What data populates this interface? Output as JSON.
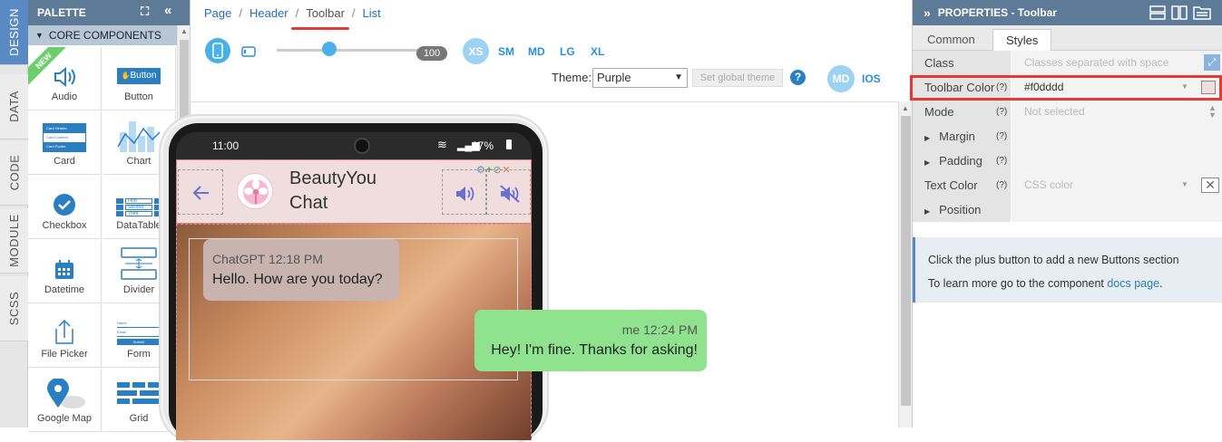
{
  "vtabs": [
    "DESIGN",
    "DATA",
    "CODE",
    "MODULE",
    "SCSS"
  ],
  "palette": {
    "title": "PALETTE",
    "section": "CORE COMPONENTS",
    "new_badge": "NEW",
    "items": [
      {
        "label": "Audio",
        "icon": "speaker-icon"
      },
      {
        "label": "Button",
        "icon": "button-icon",
        "inner": "Button"
      },
      {
        "label": "Card",
        "icon": "card-icon",
        "lines": [
          "Card Header",
          "Card Content",
          "Card Footer"
        ]
      },
      {
        "label": "Chart",
        "icon": "chart-icon"
      },
      {
        "label": "Checkbox",
        "icon": "checkbox-icon"
      },
      {
        "label": "DataTable",
        "icon": "datatable-icon",
        "rows": [
          "First",
          "Second",
          "Third"
        ]
      },
      {
        "label": "Datetime",
        "icon": "calendar-icon"
      },
      {
        "label": "Divider",
        "icon": "divider-icon"
      },
      {
        "label": "File Picker",
        "icon": "upload-icon"
      },
      {
        "label": "Form",
        "icon": "form-icon",
        "lines": [
          "Name",
          "Email",
          "Submit"
        ]
      },
      {
        "label": "Google Map",
        "icon": "map-pin-icon"
      },
      {
        "label": "Grid",
        "icon": "grid-icon"
      }
    ]
  },
  "breadcrumb": [
    "Page",
    "Header",
    "Toolbar",
    "List"
  ],
  "toolbar": {
    "zoom": "100",
    "breakpoints": [
      "XS",
      "SM",
      "MD",
      "LG",
      "XL"
    ],
    "theme_label": "Theme:",
    "theme_value": "Purple",
    "set_global": "Set global theme",
    "help": "?",
    "md": "MD",
    "ios": "IOS"
  },
  "phone": {
    "time": "11:00",
    "battery": "97%",
    "title_line1": "BeautyYou",
    "title_line2": "Chat",
    "msg_in_meta": "ChatGPT 12:18 PM",
    "msg_in_text": "Hello. How are you today?",
    "msg_out_meta": "me 12:24 PM",
    "msg_out_text": "Hey! I'm fine. Thanks for asking!"
  },
  "properties": {
    "title": "PROPERTIES - Toolbar",
    "tabs": [
      "Common",
      "Styles"
    ],
    "rows": [
      {
        "label": "Class",
        "value": "Classes separated with space"
      },
      {
        "label": "Toolbar Color",
        "value": "#f0dddd"
      },
      {
        "label": "Mode",
        "value": "Not selected"
      },
      {
        "label": "Margin",
        "value": ""
      },
      {
        "label": "Padding",
        "value": ""
      },
      {
        "label": "Text Color",
        "value": "CSS color"
      },
      {
        "label": "Position",
        "value": ""
      }
    ],
    "q": "(?)",
    "info_line1": "Click the plus button to add a new Buttons section",
    "info_line2_prefix": "To learn more go to the component ",
    "info_link": "docs page",
    "info_suffix": "."
  },
  "colors": {
    "accent": "#5a8ac6",
    "toolbar_color": "#f0dddd",
    "highlight": "#e53935"
  }
}
